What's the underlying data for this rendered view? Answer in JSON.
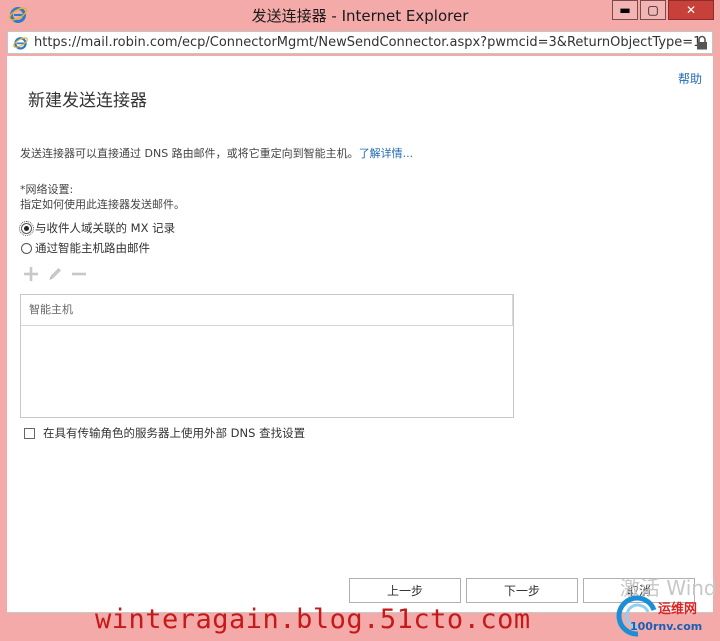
{
  "window": {
    "title": "发送连接器 - Internet Explorer",
    "minimize_label": "▬",
    "maximize_label": "▢",
    "close_label": "✕"
  },
  "address_bar": {
    "url": "https://mail.robin.com/ecp/ConnectorMgmt/NewSendConnector.aspx?pwmcid=3&ReturnObjectType=1"
  },
  "page": {
    "help_label": "帮助",
    "heading": "新建发送连接器",
    "description": "发送连接器可以直接通过 DNS 路由邮件，或将它重定向到智能主机。",
    "learn_more": "了解详情...",
    "network_label": "*网络设置:",
    "network_desc": "指定如何使用此连接器发送邮件。",
    "options": [
      {
        "label": "与收件人域关联的 MX 记录",
        "checked": true
      },
      {
        "label": "通过智能主机路由邮件",
        "checked": false
      }
    ],
    "list_header": "智能主机",
    "external_dns_label": "在具有传输角色的服务器上使用外部 DNS 查找设置",
    "external_dns_checked": false
  },
  "footer": {
    "back_label": "上一步",
    "next_label": "下一步",
    "cancel_label": "取消"
  },
  "watermark": {
    "blog": "winteragain.blog.51cto.com",
    "windows": "激活 Wind",
    "logo_text": "运维网",
    "logo_sub": "100rnv.com"
  },
  "colors": {
    "titlebar": "#f4aaa9",
    "link": "#1f6bb5",
    "watermark": "#c51a1a"
  }
}
